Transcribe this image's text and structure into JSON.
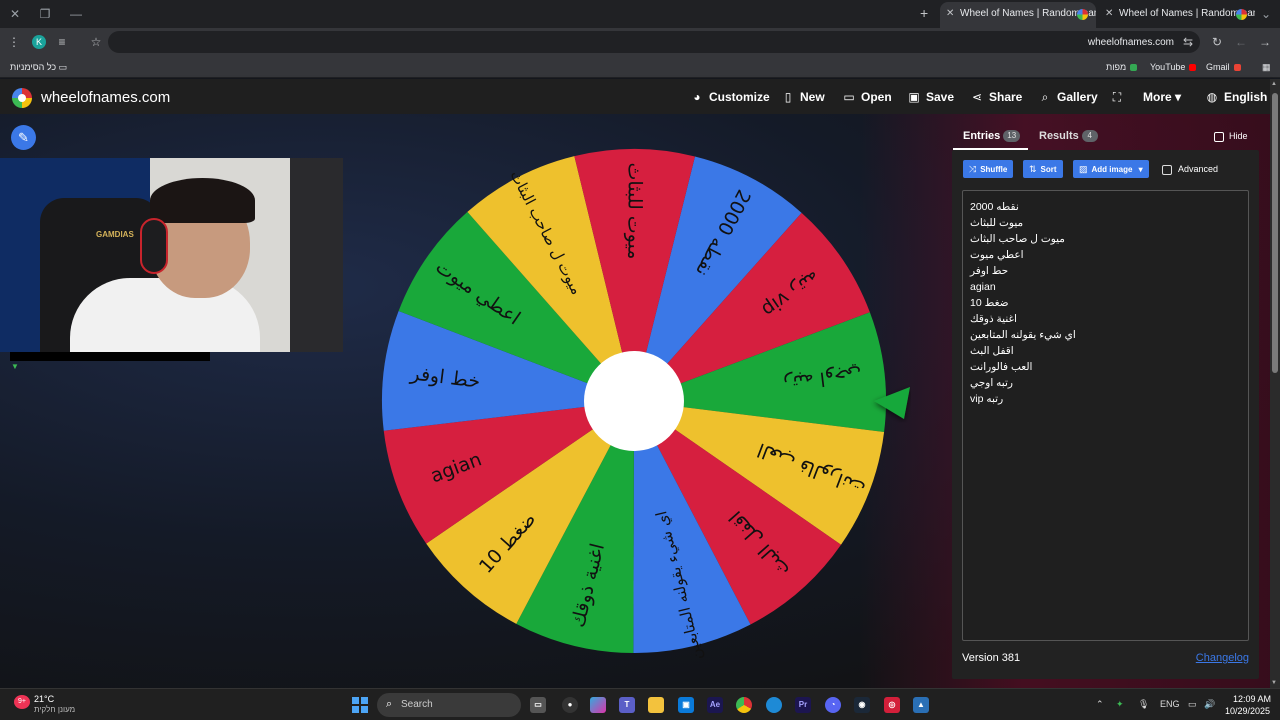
{
  "browser": {
    "tabs": [
      {
        "title": "Wheel of Names | Random nam",
        "active": true
      },
      {
        "title": "Wheel of Names | Random nam",
        "active": false
      }
    ],
    "url": "wheelofnames.com",
    "profile_initial": "K",
    "bookmarks": {
      "all_bookmarks": "כל הסימניות",
      "folder_label": "כל הסימניות",
      "items": [
        "Gmail",
        "YouTube",
        "מפות"
      ]
    }
  },
  "site": {
    "logo": "wheelofnames.com",
    "nav": {
      "customize": "Customize",
      "new": "New",
      "open": "Open",
      "save": "Save",
      "share": "Share",
      "gallery": "Gallery",
      "more": "More",
      "language": "English"
    }
  },
  "wheel": {
    "segments": [
      {
        "label": "نقطه 2000",
        "color": "#3b78e7"
      },
      {
        "label": "رتبه vip",
        "color": "#d61f3f"
      },
      {
        "label": "رتبه اوجي",
        "color": "#19a83a"
      },
      {
        "label": "العب فالورانت",
        "color": "#eec12d"
      },
      {
        "label": "اقفل البث",
        "color": "#d61f3f"
      },
      {
        "label": "اي شيء يقولنه المتابعين",
        "color": "#3b78e7"
      },
      {
        "label": "اغنية ذوقك",
        "color": "#19a83a"
      },
      {
        "label": "ضغط 10",
        "color": "#eec12d"
      },
      {
        "label": "agian",
        "color": "#d61f3f"
      },
      {
        "label": "خط اوفر",
        "color": "#3b78e7"
      },
      {
        "label": "اعطي ميوت",
        "color": "#19a83a"
      },
      {
        "label": "ميوت ل صاحب البثاث",
        "color": "#eec12d"
      },
      {
        "label": "ميوت للبثاث",
        "color": "#d61f3f"
      }
    ],
    "pointer_color": "#19a83a"
  },
  "panel": {
    "tab_entries": "Entries",
    "entries_count": "13",
    "tab_results": "Results",
    "results_count": "4",
    "hide_label": "Hide",
    "shuffle": "Shuffle",
    "sort": "Sort",
    "add_image": "Add image",
    "advanced": "Advanced",
    "entries": [
      "نقطه 2000",
      "ميوت للبثاث",
      "ميوت ل صاحب البثاث",
      "اعطي ميوت",
      "حط اوفر",
      "agian",
      "ضغط 10",
      "اغنية ذوقك",
      "اي شيء يقولنه المتابعين",
      "اقفل البث",
      "العب فالورانت",
      "رتبه اوجي",
      "رتبه vip"
    ],
    "version": "Version 381",
    "changelog": "Changelog"
  },
  "webcam": {
    "chair_brand": "GAMDIAS"
  },
  "taskbar": {
    "weather_badge": "9+",
    "temperature": "21°C",
    "weather_desc": "מעונן חלקית",
    "search_placeholder": "Search",
    "language": "ENG",
    "time": "12:09 AM",
    "date": "10/29/2025"
  }
}
